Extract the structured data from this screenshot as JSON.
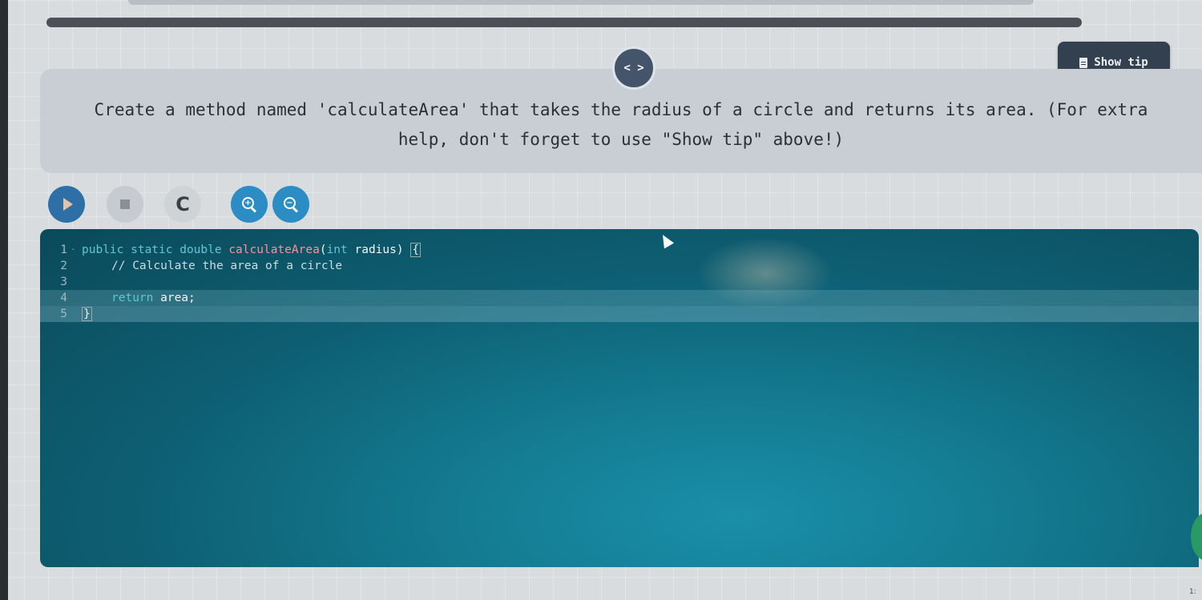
{
  "progress": {
    "percent": 100
  },
  "header": {
    "show_tip_label": "Show tip",
    "show_tip_icon": "document-icon",
    "toggle_code_label": "< >",
    "toggle_code_icon": "code-icon"
  },
  "prompt": {
    "text": "Create a method named 'calculateArea' that takes the radius of a circle and returns its area. (For extra help, don't forget to use \"Show tip\" above!)"
  },
  "toolbar": {
    "buttons": [
      {
        "name": "run",
        "icon": "play-icon"
      },
      {
        "name": "stop",
        "icon": "stop-icon"
      },
      {
        "name": "reset",
        "icon": "refresh-icon",
        "glyph": "C"
      },
      {
        "name": "zoom-in",
        "icon": "zoom-in-icon",
        "glyph": "+"
      },
      {
        "name": "zoom-out",
        "icon": "zoom-out-icon",
        "glyph": "−"
      }
    ]
  },
  "editor": {
    "lines": [
      {
        "number": "1",
        "tokens": {
          "kw1": "public static double ",
          "fn": "calculateArea",
          "paren": "(",
          "kw2": "int",
          "rest": " radius) ",
          "brace": "{"
        }
      },
      {
        "number": "2",
        "comment": "// Calculate the area of a circle"
      },
      {
        "number": "3"
      },
      {
        "number": "4",
        "kw": "return",
        "rest": " area;"
      },
      {
        "number": "5",
        "brace": "}"
      }
    ],
    "active_line": 5
  },
  "corner_text": "1:"
}
